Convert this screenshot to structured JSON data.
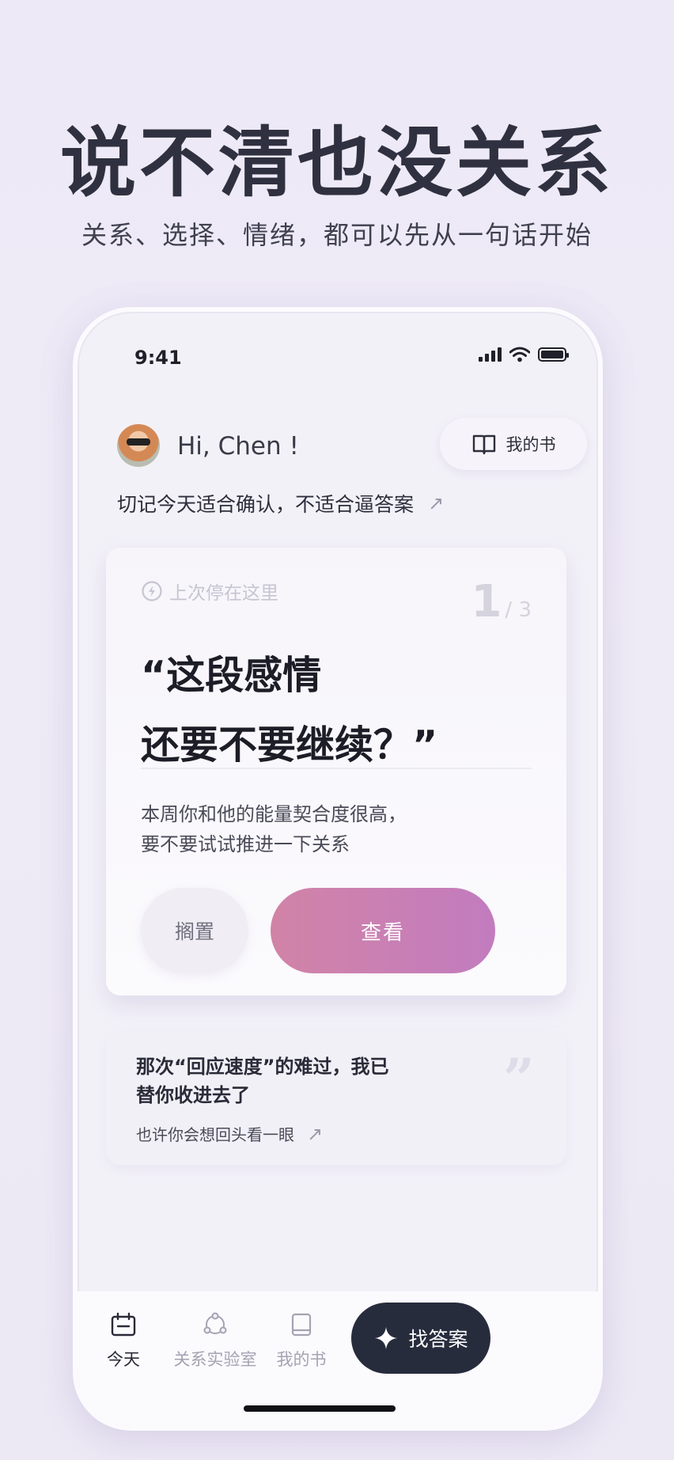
{
  "promo": {
    "headline": "说不清也没关系",
    "subline": "关系、选择、情绪，都可以先从一句话开始"
  },
  "status_bar": {
    "time": "9:41"
  },
  "header": {
    "greeting": "Hi, Chen !",
    "my_book_button": "我的书",
    "tip": "切记今天适合确认，不适合逼答案"
  },
  "main_card": {
    "resume_label": "上次停在这里",
    "page_current": "1",
    "page_total": "/ 3",
    "quote_line1": "“这段感情",
    "quote_line2": "还要不要继续？”",
    "desc_line1": "本周你和他的能量契合度很高，",
    "desc_line2": "要不要试试推进一下关系",
    "shelve_button": "搁置",
    "view_button": "查看"
  },
  "memory_card": {
    "text_line1": "那次“回应速度”的难过，我已",
    "text_line2": "替你收进去了",
    "link": "也许你会想回头看一眼",
    "quote_mark": "”"
  },
  "tabbar": {
    "today": "今天",
    "lab": "关系实验室",
    "book": "我的书",
    "ask": "找答案"
  },
  "colors": {
    "accent_gradient_start": "#D183A6",
    "accent_gradient_end": "#C27CBF",
    "dark_button": "#272C3D"
  },
  "icons": [
    "signal-icon",
    "wifi-icon",
    "battery-icon",
    "book-icon",
    "lightning-icon",
    "arrow-up-right-icon",
    "calendar-icon",
    "network-icon",
    "sparkle-icon"
  ]
}
